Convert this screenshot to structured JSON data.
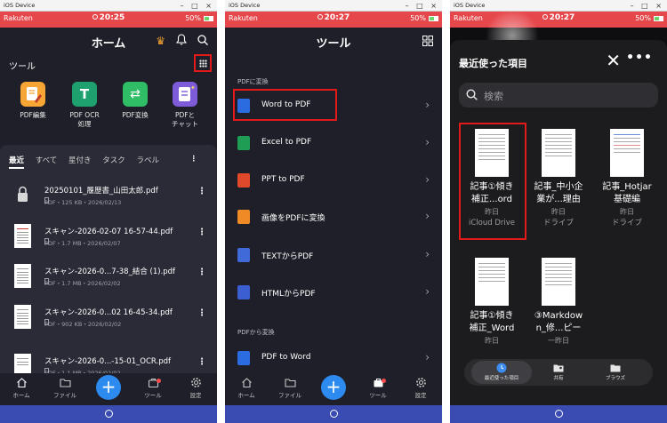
{
  "chrome": {
    "title": "iOS Device",
    "controls": "– □ ×"
  },
  "panel1": {
    "status": {
      "carrier": "Rakuten",
      "time": "20:25",
      "battery": "50%"
    },
    "title": "ホーム",
    "tools_header": "ツール",
    "tools": [
      {
        "label": "PDF編集"
      },
      {
        "label": "PDF OCR 処理"
      },
      {
        "label": "PDF変換"
      },
      {
        "label": "PDFと チャット"
      }
    ],
    "tabs": [
      "最近",
      "すべて",
      "星付き",
      "タスク",
      "ラベル"
    ],
    "files": [
      {
        "name": "20250101_履歴書_山田太郎.pdf",
        "meta": "PDF・125 KB・2026/02/13"
      },
      {
        "name": "スキャン-2026-02-07 16-57-44.pdf",
        "meta": "PDF・1.7 MB・2026/02/07"
      },
      {
        "name": "スキャン-2026-0...7-38_結合 (1).pdf",
        "meta": "PDF・1.7 MB・2026/02/02"
      },
      {
        "name": "スキャン-2026-0...02 16-45-34.pdf",
        "meta": "PDF・902 KB・2026/02/02"
      },
      {
        "name": "スキャン-2026-0...-15-01_OCR.pdf",
        "meta": "PDF・1.1 MB・2026/02/02"
      }
    ],
    "tabbar": {
      "home": "ホーム",
      "files": "ファイル",
      "tools": "ツール",
      "settings": "設定"
    }
  },
  "panel2": {
    "status": {
      "carrier": "Rakuten",
      "time": "20:27",
      "battery": "50%"
    },
    "title": "ツール",
    "section_to": "PDFに変換",
    "to_items": [
      {
        "label": "Word to PDF",
        "color": "#2b6ce0"
      },
      {
        "label": "Excel to PDF",
        "color": "#1f9d55"
      },
      {
        "label": "PPT to PDF",
        "color": "#e0492b"
      },
      {
        "label": "画像をPDFに変換",
        "color": "#f08a24"
      },
      {
        "label": "TEXTからPDF",
        "color": "#3f6ad8"
      },
      {
        "label": "HTMLからPDF",
        "color": "#3b5fd0"
      }
    ],
    "section_from": "PDFから変換",
    "from_items": [
      {
        "label": "PDF to Word",
        "color": "#2b6ce0"
      }
    ],
    "tabbar": {
      "home": "ホーム",
      "files": "ファイル",
      "tools": "ツール",
      "settings": "設定"
    }
  },
  "panel3": {
    "status": {
      "carrier": "Rakuten",
      "time": "20:27",
      "battery": "50%"
    },
    "title": "最近使った項目",
    "search_placeholder": "検索",
    "docs": [
      {
        "name1": "記事①傾き",
        "name2": "補正...ord",
        "date": "昨日",
        "loc": "iCloud Drive"
      },
      {
        "name1": "記事_中小企",
        "name2": "業が...理由",
        "date": "昨日",
        "loc": "ドライブ"
      },
      {
        "name1": "記事_Hotjar",
        "name2": "基礎編",
        "date": "昨日",
        "loc": "ドライブ"
      },
      {
        "name1": "記事①傾き",
        "name2": "補正_Word",
        "date": "昨日",
        "loc": ""
      },
      {
        "name1": "③Markdow",
        "name2": "n_修...ピー",
        "date": "一昨日",
        "loc": ""
      }
    ],
    "tabbar": {
      "recent": "最近使った項目",
      "shared": "共有",
      "browse": "ブラウズ"
    }
  }
}
